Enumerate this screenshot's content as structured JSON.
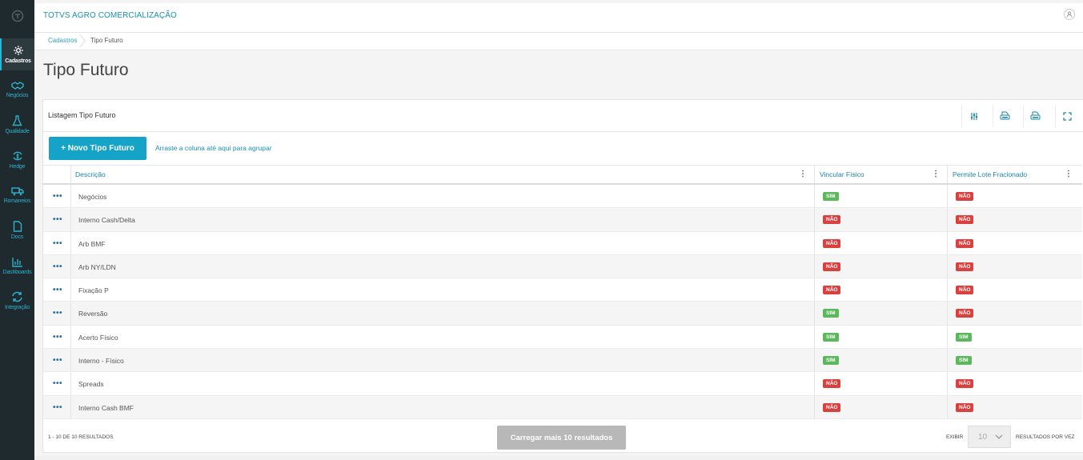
{
  "app": {
    "brand": "TOTVS AGRO COMERCIALIZAÇÃO"
  },
  "sidebar": {
    "items": [
      {
        "label": "Cadastros",
        "icon": "gear-icon",
        "active": true
      },
      {
        "label": "Negócios",
        "icon": "handshake-icon"
      },
      {
        "label": "Qualidade",
        "icon": "flask-icon"
      },
      {
        "label": "Hedge",
        "icon": "dollar-arrows-icon"
      },
      {
        "label": "Romaneios",
        "icon": "truck-icon"
      },
      {
        "label": "Docs",
        "icon": "document-icon"
      },
      {
        "label": "Dashboards",
        "icon": "bar-chart-icon"
      },
      {
        "label": "Integração",
        "icon": "sync-icon"
      }
    ]
  },
  "breadcrumb": {
    "items": [
      "Cadastros",
      "Tipo Futuro"
    ]
  },
  "page": {
    "title": "Tipo Futuro"
  },
  "list": {
    "title": "Listagem Tipo Futuro",
    "tools": [
      "columns-settings-icon",
      "export-excel-icon",
      "export-pdf-icon",
      "fullscreen-icon"
    ],
    "new_button": "+ Novo Tipo Futuro",
    "group_hint": "Arraste a coluna até aqui para agrupar",
    "columns": [
      "Descrição",
      "Vincular Físico",
      "Permite Lote Fracionado"
    ],
    "row_action": "•••",
    "rows": [
      {
        "descricao": "Negócios",
        "vincular": "SIM",
        "permite": "NÃO"
      },
      {
        "descricao": "Interno Cash/Delta",
        "vincular": "NÃO",
        "permite": "NÃO"
      },
      {
        "descricao": "Arb BMF",
        "vincular": "NÃO",
        "permite": "NÃO"
      },
      {
        "descricao": "Arb NY/LDN",
        "vincular": "NÃO",
        "permite": "NÃO"
      },
      {
        "descricao": "Fixação P",
        "vincular": "NÃO",
        "permite": "NÃO"
      },
      {
        "descricao": "Reversão",
        "vincular": "SIM",
        "permite": "NÃO"
      },
      {
        "descricao": "Acerto Físico",
        "vincular": "SIM",
        "permite": "SIM"
      },
      {
        "descricao": "Interno - Físico",
        "vincular": "SIM",
        "permite": "SIM"
      },
      {
        "descricao": "Spreads",
        "vincular": "NÃO",
        "permite": "NÃO"
      },
      {
        "descricao": "Interno Cash BMF",
        "vincular": "NÃO",
        "permite": "NÃO"
      }
    ]
  },
  "footer": {
    "count": "1 - 10 DE 10 RESULTADOS",
    "load_more": "Carregar mais 10 resultados",
    "show_label": "EXIBIR",
    "page_size": "10",
    "per_page_label": "RESULTADOS POR VEZ"
  },
  "colors": {
    "accent": "#16a3c8",
    "sidebar": "#1e2a2d",
    "sim": "#5cb85c",
    "nao": "#d9413f"
  }
}
